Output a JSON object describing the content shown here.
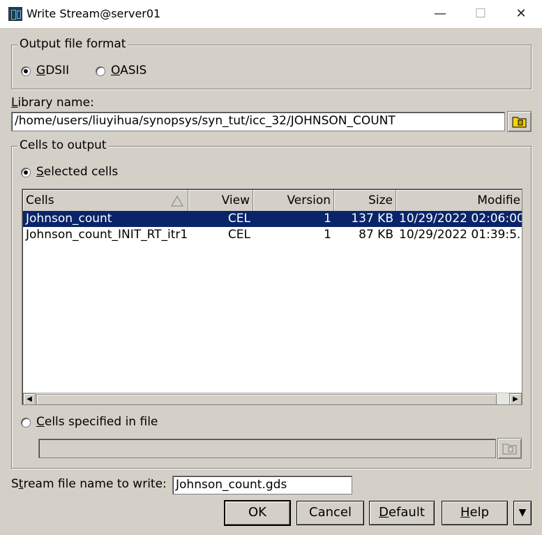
{
  "window": {
    "title": "Write Stream@server01",
    "minimize_glyph": "—",
    "maximize_glyph": "☐",
    "close_glyph": "✕"
  },
  "output_format": {
    "legend": "Output file format",
    "options": [
      {
        "underline": "G",
        "rest": "DSII",
        "checked": true
      },
      {
        "underline": "O",
        "rest": "ASIS",
        "checked": false
      }
    ]
  },
  "library": {
    "label_underline": "L",
    "label_rest": "ibrary name:",
    "value": "/home/users/liuyihua/synopsys/syn_tut/icc_32/JOHNSON_COUNT",
    "browse_icon": "folder-icon"
  },
  "cells_group": {
    "legend": "Cells to output",
    "selected_option": {
      "underline": "S",
      "rest": "elected cells",
      "checked": true
    },
    "file_option": {
      "underline": "C",
      "rest": "ells specified in file",
      "checked": false
    },
    "file_value": ""
  },
  "table": {
    "columns": [
      "Cells",
      "View",
      "Version",
      "Size",
      "Modifie"
    ],
    "rows": [
      {
        "cells": "Johnson_count",
        "view": "CEL",
        "version": "1",
        "size": "137 KB",
        "modified": "10/29/2022 02:06:00...",
        "selected": true
      },
      {
        "cells": "Johnson_count_INIT_RT_itr1",
        "view": "CEL",
        "version": "1",
        "size": "87 KB",
        "modified": "10/29/2022 01:39:5...",
        "selected": false
      }
    ]
  },
  "stream": {
    "label_pre": "S",
    "label_underline": "t",
    "label_rest": "ream file name to write:",
    "value": "Johnson_count.gds"
  },
  "buttons": {
    "ok": "OK",
    "cancel": "Cancel",
    "default_underline": "D",
    "default_rest": "efault",
    "help_underline": "H",
    "help_rest": "elp",
    "more_glyph": "▼"
  },
  "colors": {
    "selection": "#0a246a",
    "dialog_bg": "#d4d0c8"
  }
}
